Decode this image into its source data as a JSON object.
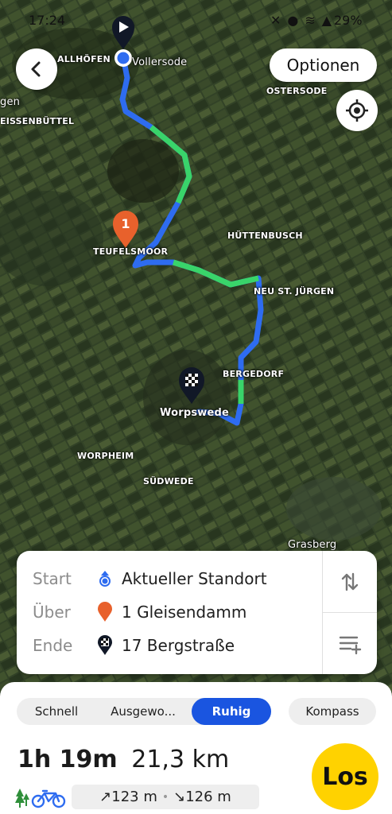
{
  "status_bar": {
    "time": "17:24",
    "battery": "29%"
  },
  "map": {
    "labels": {
      "allhoefen": "ALLHÖFEN",
      "vollersode": "Vollersode",
      "ostersode": "OSTERSODE",
      "gen": "gen",
      "eissenbuettel": "EISSENBÜTTEL",
      "teufelsmoor": "TEUFELSMOOR",
      "huettenbusch": "HÜTTENBUSCH",
      "neu_st_juergen": "NEU ST. JÜRGEN",
      "bergedorf": "BERGEDORF",
      "worpswede": "Worpswede",
      "worpheim": "WORPHEIM",
      "suedwede": "SÜDWEDE",
      "grasberg": "Grasberg"
    },
    "via_marker_number": "1",
    "route_colors": {
      "route": "#2e6cf0",
      "quiet_section": "#39d46a"
    }
  },
  "header": {
    "back_icon": "chevron-left-icon",
    "options_label": "Optionen",
    "locate_icon": "crosshair-icon"
  },
  "route_card": {
    "start_label": "Start",
    "start_value": "Aktueller Standort",
    "via_label": "Über",
    "via_value": "1 Gleisendamm",
    "end_label": "Ende",
    "end_value": "17 Bergstraße",
    "swap_icon": "swap-vertical-icon",
    "add_stop_icon": "add-stop-icon"
  },
  "bottom": {
    "modes": [
      "Schnell",
      "Ausgewo...",
      "Ruhig"
    ],
    "active_mode": "Ruhig",
    "kompass_label": "Kompass",
    "duration": "1h 19m",
    "distance": "21,3 km",
    "ascent": "↗123 m",
    "descent": "↘126 m",
    "elev_separator": "•",
    "go_label": "Los",
    "accent": "#1a55e0",
    "go_color": "#ffd200"
  }
}
